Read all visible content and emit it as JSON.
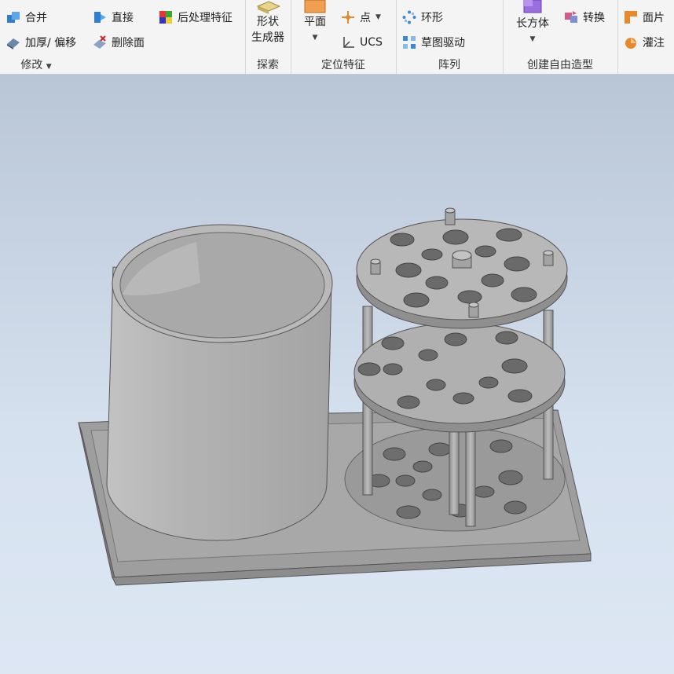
{
  "ribbon": {
    "modify": {
      "title": "修改",
      "combine": "合并",
      "thicken": "加厚/ 偏移",
      "direct": "直接",
      "delete_face": "删除面",
      "post_process": "后处理特征"
    },
    "explore": {
      "title": "探索",
      "shape_gen_line1": "形状",
      "shape_gen_line2": "生成器"
    },
    "work_features": {
      "title": "定位特征",
      "plane": "平面",
      "point": "点",
      "ucs": "UCS"
    },
    "pattern": {
      "title": "阵列",
      "circular": "环形",
      "sketch_driven": "草图驱动"
    },
    "freeform": {
      "title": "创建自由造型",
      "box": "长方体",
      "convert": "转换"
    },
    "surface": {
      "patch": "面片",
      "fill": "灌注"
    }
  },
  "colors": {
    "ribbon_bg": "#f4f4f4",
    "viewport_top": "#b9c6d6",
    "viewport_bottom": "#dde7f4",
    "model_gray": "#a9a9a9"
  }
}
